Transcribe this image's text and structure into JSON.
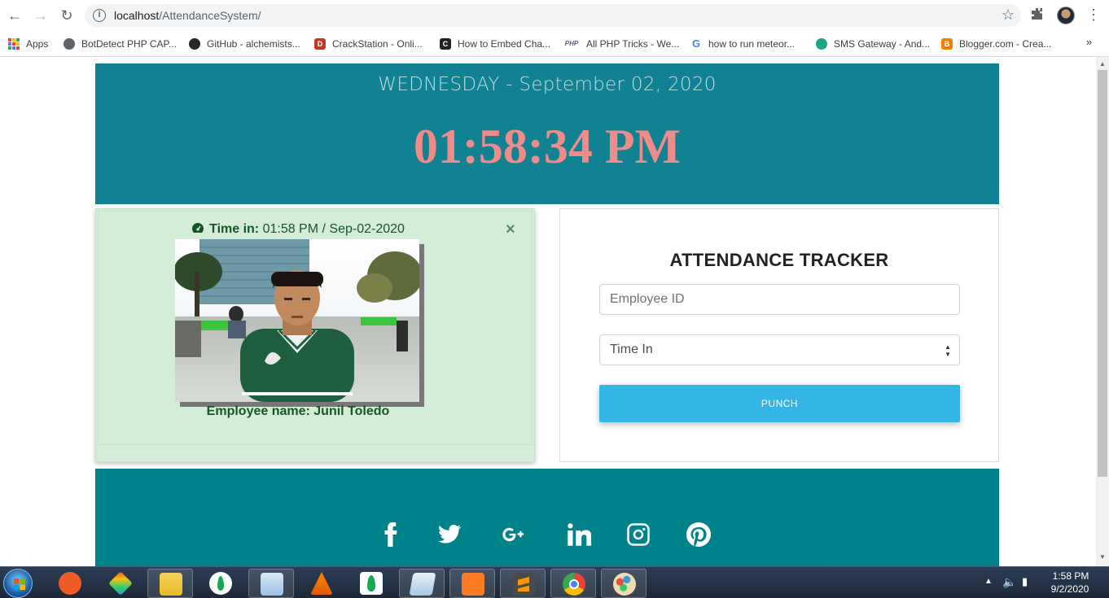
{
  "browser": {
    "url_host": "localhost",
    "url_path": "/AttendanceSystem/",
    "bookmarks": [
      {
        "label": "Apps",
        "icon": "apps-grid-icon",
        "color": "#e8453c"
      },
      {
        "label": "BotDetect PHP CAP...",
        "icon": "globe-icon",
        "color": "#5f6368"
      },
      {
        "label": "GitHub - alchemists...",
        "icon": "github-icon",
        "color": "#24292e"
      },
      {
        "label": "CrackStation - Onli...",
        "icon": "crackstation-icon",
        "color": "#c0392b"
      },
      {
        "label": "How to Embed Cha...",
        "icon": "ch-icon",
        "color": "#222222"
      },
      {
        "label": "All PHP Tricks - We...",
        "icon": "php-icon",
        "color": "#4f5b93"
      },
      {
        "label": "how to run meteor...",
        "icon": "google-icon",
        "color": "#4285f4"
      },
      {
        "label": "SMS Gateway - And...",
        "icon": "sms-icon",
        "color": "#1ba784"
      },
      {
        "label": "Blogger.com - Crea...",
        "icon": "blogger-icon",
        "color": "#f57d00"
      }
    ],
    "more": "»"
  },
  "header": {
    "date": "WEDNESDAY - September 02, 2020",
    "time": "01:58:34 PM"
  },
  "alert": {
    "label": "Time in:",
    "value": " 01:58 PM / Sep-02-2020",
    "close": "×",
    "employee_name": "Employee name: Junil Toledo"
  },
  "tracker": {
    "title": "ATTENDANCE TRACKER",
    "employee_id_placeholder": "Employee ID",
    "employee_id_value": "",
    "status_selected": "Time In",
    "punch_label": "PUNCH"
  },
  "footer": {
    "socials": [
      "facebook-icon",
      "twitter-icon",
      "google-plus-icon",
      "linkedin-icon",
      "instagram-icon",
      "pinterest-icon"
    ]
  },
  "taskbar": {
    "time": "1:58 PM",
    "date": "9/2/2020"
  },
  "colors": {
    "header_bg": "#108292",
    "clock": "#f08b89",
    "footer_bg": "#00828a",
    "alert_bg": "#d4edd9",
    "punch": "#33b5e5"
  }
}
